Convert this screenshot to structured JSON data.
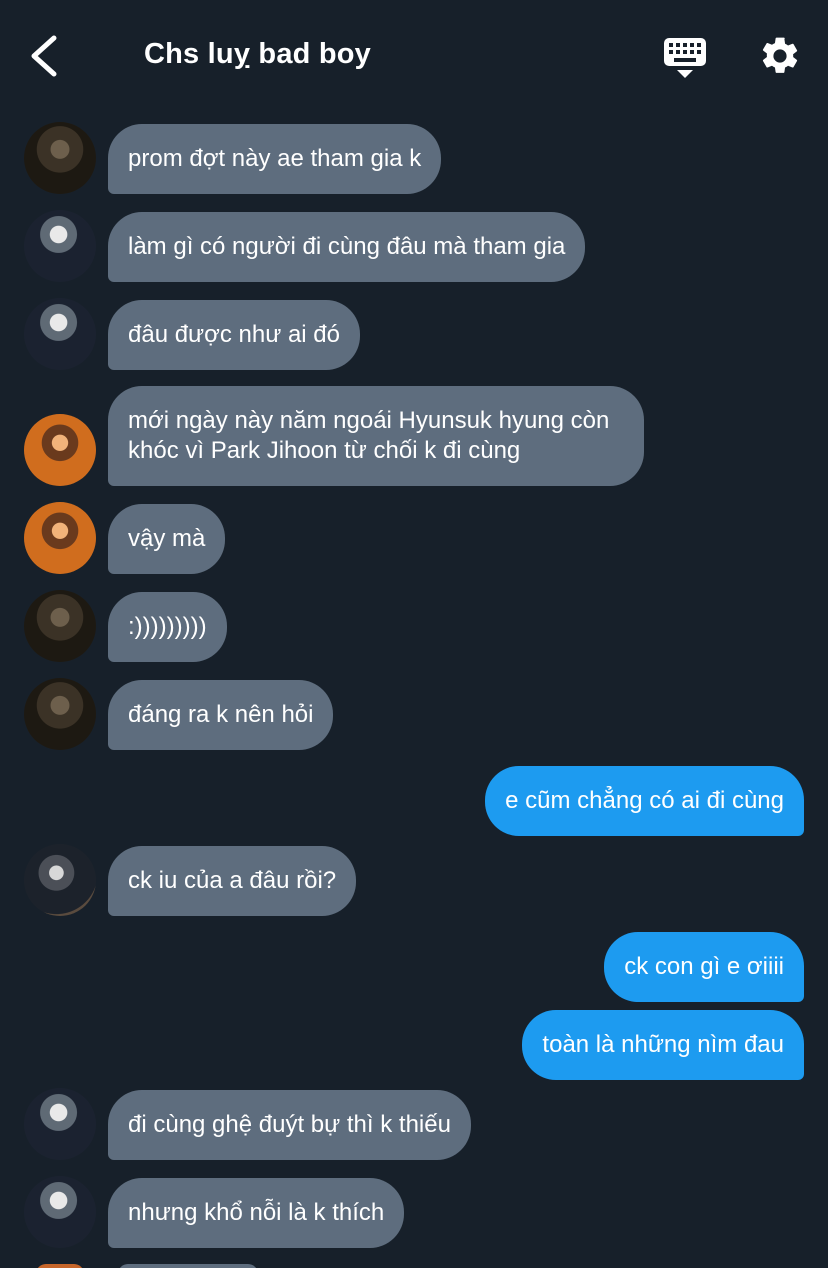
{
  "header": {
    "title": "Chs luỵ bad boy",
    "back_icon": "chevron-left-icon",
    "keyboard_icon": "keyboard-icon",
    "settings_icon": "gear-icon"
  },
  "colors": {
    "background": "#17202a",
    "incoming_bubble": "#5e6d7e",
    "outgoing_bubble": "#1d9bf0",
    "text": "#ffffff"
  },
  "messages": [
    {
      "text": "prom đợt này ae tham gia k",
      "direction": "in",
      "avatar": "user-a"
    },
    {
      "text": "làm gì có người đi cùng đâu mà tham gia",
      "direction": "in",
      "avatar": "user-b"
    },
    {
      "text": "đâu được như ai đó",
      "direction": "in",
      "avatar": "user-b"
    },
    {
      "text": "mới ngày này năm ngoái Hyunsuk hyung còn khóc vì Park Jihoon từ chối k đi cùng",
      "direction": "in",
      "avatar": "user-c"
    },
    {
      "text": "vậy mà",
      "direction": "in",
      "avatar": "user-c"
    },
    {
      "text": ":)))))))))",
      "direction": "in",
      "avatar": "user-a"
    },
    {
      "text": "đáng ra k nên hỏi",
      "direction": "in",
      "avatar": "user-a"
    },
    {
      "text": "e cũm chẳng có ai đi cùng",
      "direction": "out"
    },
    {
      "text": "ck iu của a đâu rồi?",
      "direction": "in",
      "avatar": "user-d"
    },
    {
      "text": "ck con gì e ơiiii",
      "direction": "out"
    },
    {
      "text": "toàn là những nìm đau",
      "direction": "out"
    },
    {
      "text": "đi cùng ghệ đuýt bự thì k thiếu",
      "direction": "in",
      "avatar": "user-b"
    },
    {
      "text": "nhưng khổ nỗi là k thích",
      "direction": "in",
      "avatar": "user-b"
    }
  ]
}
